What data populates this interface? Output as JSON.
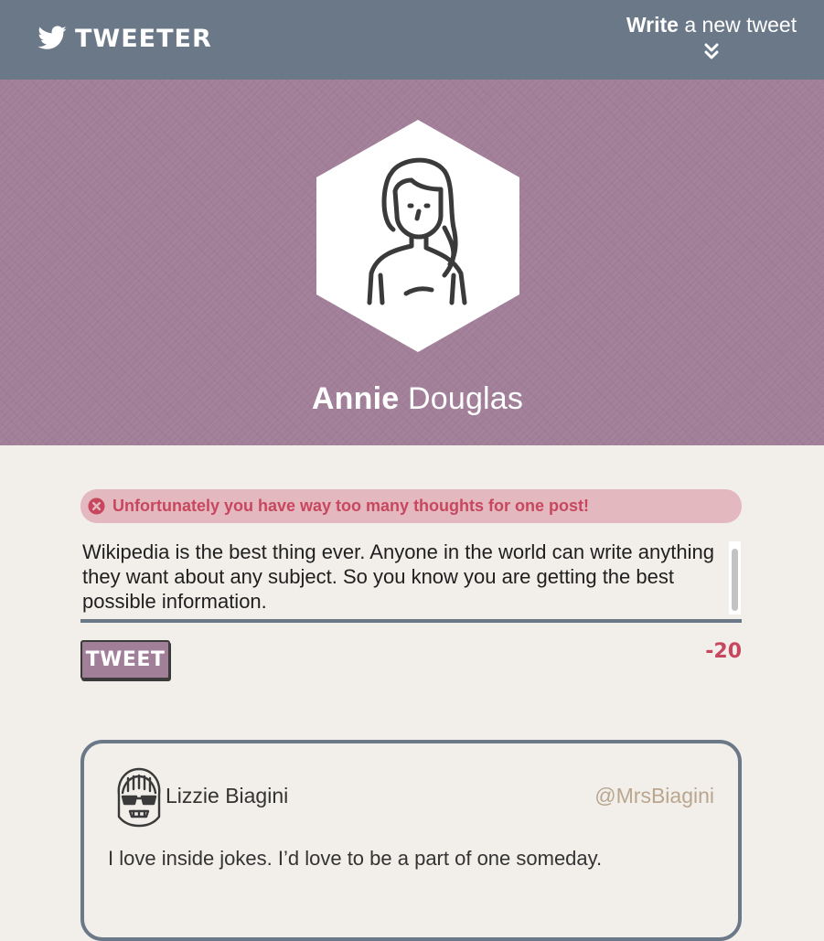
{
  "nav": {
    "brand_name": "TWEETER",
    "compose_bold": "Write",
    "compose_rest": " a new tweet",
    "icons": {
      "logo": "bird-icon",
      "compose_toggle": "double-chevron-down-icon"
    }
  },
  "profile": {
    "first_name": "Annie",
    "last_name": " Douglas",
    "avatar": "woman-outline-avatar"
  },
  "compose": {
    "error_message": "Unfortunately you have way too many thoughts for one post!",
    "error_icon": "error-circle-x-icon",
    "text": "Wikipedia is the best thing ever. Anyone in the world can write anything they want about any subject. So you know you are getting the best possible information.",
    "tweet_button_label": "TWEET",
    "char_counter": "-20"
  },
  "feed": [
    {
      "name": "Lizzie Biagini",
      "handle": "@MrsBiagini",
      "text": "I love inside jokes. I’d love to be a part of one someday.",
      "avatar": "girl-sunglasses-avatar"
    }
  ],
  "colors": {
    "nav_bg": "#6b7888",
    "banner_bg": "#a27f99",
    "page_bg": "#f2efea",
    "error_bg": "#e4b8bf",
    "error_text": "#c7475f",
    "handle_text": "#b9a68f"
  }
}
